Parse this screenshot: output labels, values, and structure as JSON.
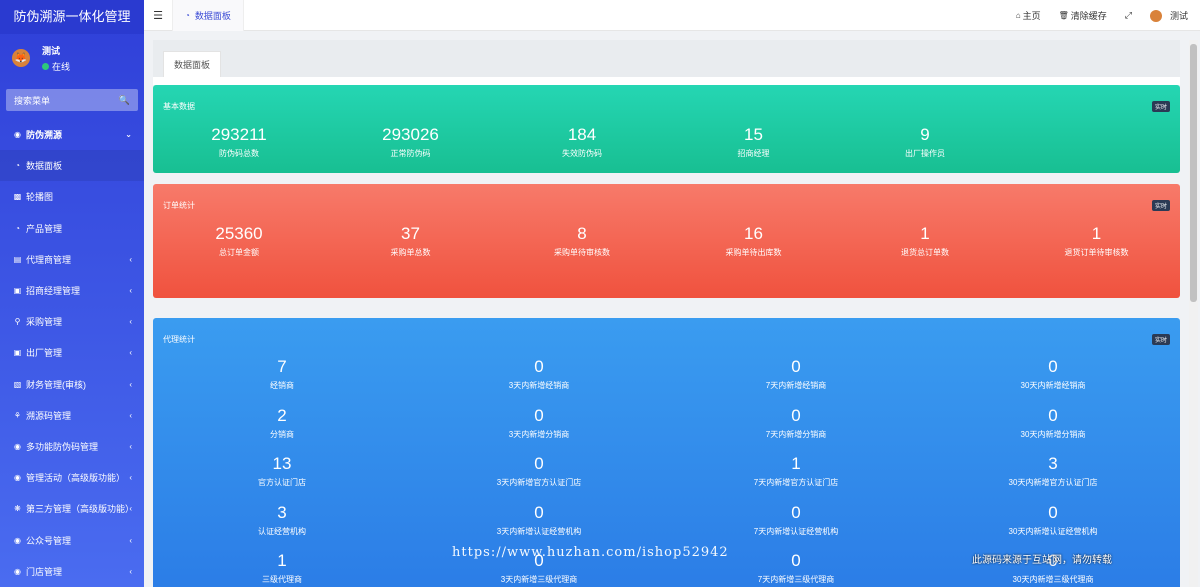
{
  "sidebar": {
    "title": "防伪溯源一体化管理",
    "user": {
      "name": "测试",
      "status": "在线"
    },
    "search_placeholder": "搜索菜单",
    "items": [
      {
        "label": "防伪溯源",
        "icon": "cube-icon",
        "chevron": "⌄"
      },
      {
        "label": "数据面板",
        "icon": "dashboard-icon",
        "chevron": ""
      },
      {
        "label": "轮播图",
        "icon": "image-icon",
        "chevron": ""
      },
      {
        "label": "产品管理",
        "icon": "product-icon",
        "chevron": ""
      },
      {
        "label": "代理商管理",
        "icon": "agent-icon",
        "chevron": "‹"
      },
      {
        "label": "招商经理管理",
        "icon": "manager-icon",
        "chevron": "‹"
      },
      {
        "label": "采购管理",
        "icon": "purchase-icon",
        "chevron": "‹"
      },
      {
        "label": "出厂管理",
        "icon": "factory-icon",
        "chevron": "‹"
      },
      {
        "label": "财务管理(审核)",
        "icon": "finance-icon",
        "chevron": "‹"
      },
      {
        "label": "溯源码管理",
        "icon": "trace-icon",
        "chevron": "‹"
      },
      {
        "label": "多功能防伪码管理",
        "icon": "code-icon",
        "chevron": "‹"
      },
      {
        "label": "管理活动（高级版功能）",
        "icon": "activity-icon",
        "chevron": "‹"
      },
      {
        "label": "第三方管理（高级版功能）",
        "icon": "third-party-icon",
        "chevron": "‹"
      },
      {
        "label": "公众号管理",
        "icon": "wechat-icon",
        "chevron": "‹"
      },
      {
        "label": "门店管理",
        "icon": "store-icon",
        "chevron": "‹"
      }
    ]
  },
  "topbar": {
    "tab": "数据面板",
    "home": "主页",
    "clear_cache": "清除缓存",
    "user": "测试"
  },
  "content": {
    "tab": "数据面板",
    "basic": {
      "title": "基本数据",
      "badge": "实时",
      "stats": [
        {
          "num": "293211",
          "label": "防伪码总数"
        },
        {
          "num": "293026",
          "label": "正常防伪码"
        },
        {
          "num": "184",
          "label": "失效防伪码"
        },
        {
          "num": "15",
          "label": "招商经理"
        },
        {
          "num": "9",
          "label": "出厂操作员"
        }
      ]
    },
    "orders": {
      "title": "订单统计",
      "badge": "实时",
      "stats": [
        {
          "num": "25360",
          "label": "总订单金额"
        },
        {
          "num": "37",
          "label": "采购单总数"
        },
        {
          "num": "8",
          "label": "采购单待审核数"
        },
        {
          "num": "16",
          "label": "采购单待出库数"
        },
        {
          "num": "1",
          "label": "退货总订单数"
        },
        {
          "num": "1",
          "label": "退货订单待审核数"
        }
      ]
    },
    "agents": {
      "title": "代理统计",
      "badge": "实时",
      "rows": [
        [
          {
            "num": "7",
            "label": "经销商"
          },
          {
            "num": "0",
            "label": "3天内新增经销商"
          },
          {
            "num": "0",
            "label": "7天内新增经销商"
          },
          {
            "num": "0",
            "label": "30天内新增经销商"
          }
        ],
        [
          {
            "num": "2",
            "label": "分销商"
          },
          {
            "num": "0",
            "label": "3天内新增分销商"
          },
          {
            "num": "0",
            "label": "7天内新增分销商"
          },
          {
            "num": "0",
            "label": "30天内新增分销商"
          }
        ],
        [
          {
            "num": "13",
            "label": "官方认证门店"
          },
          {
            "num": "0",
            "label": "3天内新增官方认证门店"
          },
          {
            "num": "1",
            "label": "7天内新增官方认证门店"
          },
          {
            "num": "3",
            "label": "30天内新增官方认证门店"
          }
        ],
        [
          {
            "num": "3",
            "label": "认证经营机构"
          },
          {
            "num": "0",
            "label": "3天内新增认证经营机构"
          },
          {
            "num": "0",
            "label": "7天内新增认证经营机构"
          },
          {
            "num": "0",
            "label": "30天内新增认证经营机构"
          }
        ],
        [
          {
            "num": "1",
            "label": "三级代理商"
          },
          {
            "num": "0",
            "label": "3天内新增三级代理商"
          },
          {
            "num": "0",
            "label": "7天内新增三级代理商"
          },
          {
            "num": "0",
            "label": "30天内新增三级代理商"
          }
        ]
      ]
    }
  },
  "watermark": {
    "url": "https://www.huzhan.com/ishop52942",
    "note": "此源码来源于互站网，请勿转载"
  }
}
